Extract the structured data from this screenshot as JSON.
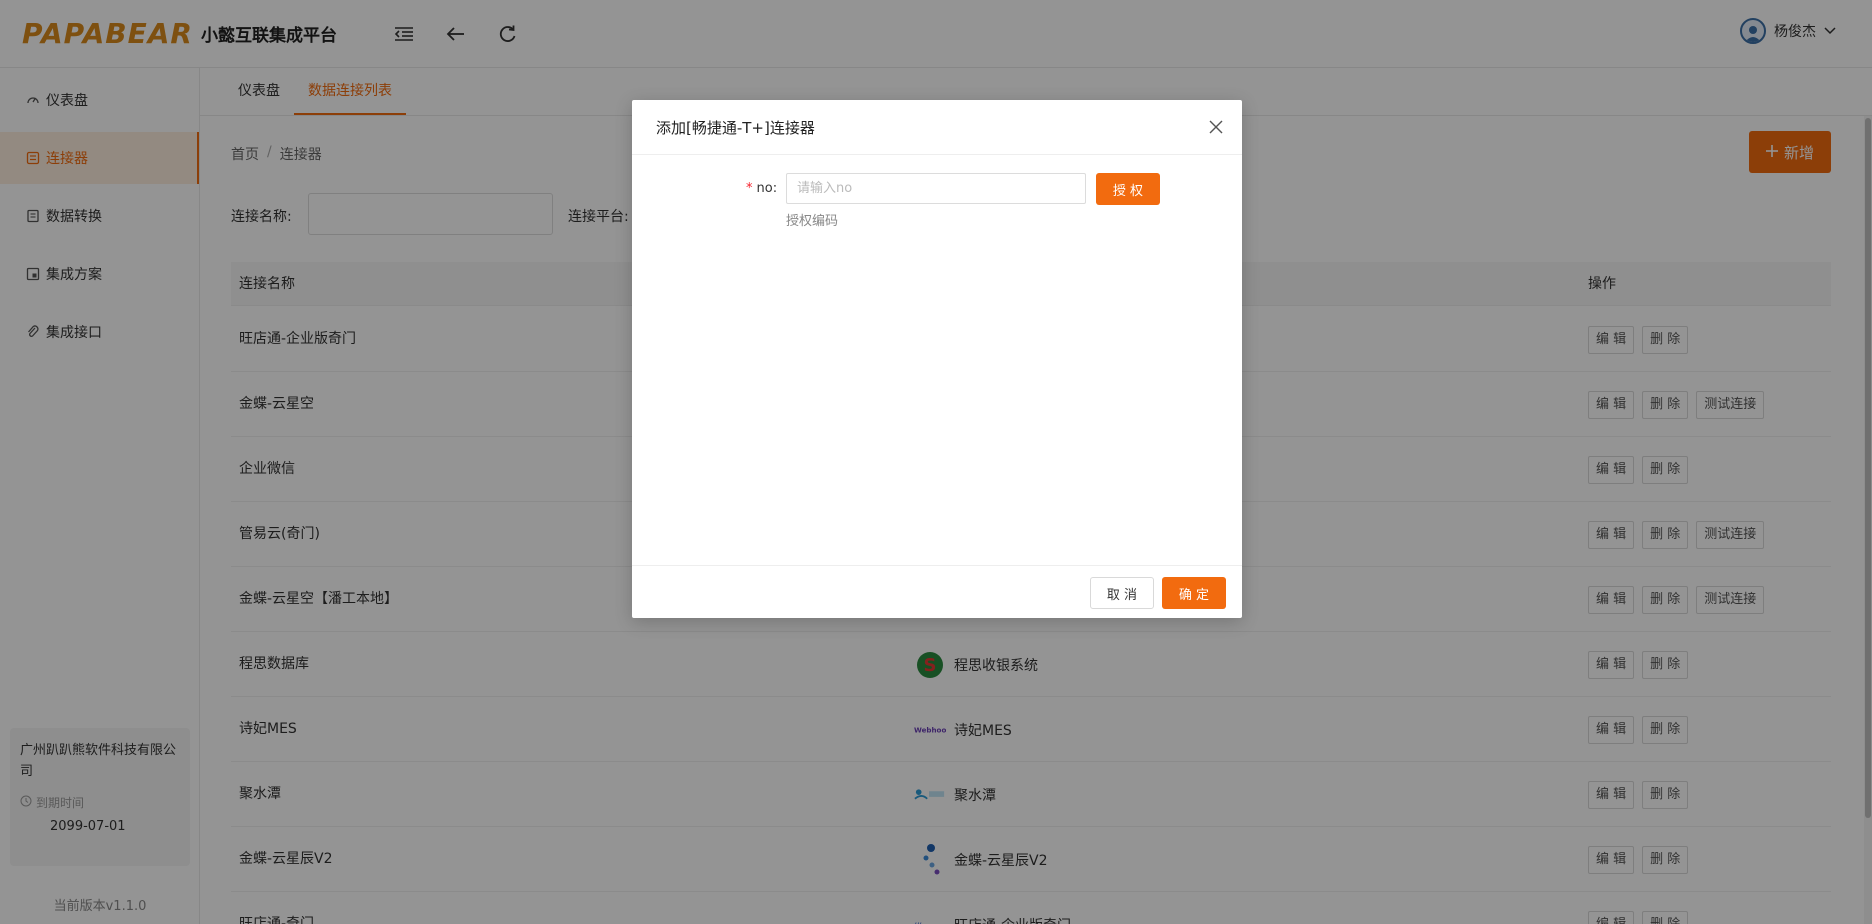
{
  "app": {
    "logo": "PAPABEAR",
    "platform_name": "小懿互联集成平台"
  },
  "header": {
    "user_name": "杨俊杰"
  },
  "sidebar": {
    "items": [
      {
        "label": "仪表盘",
        "icon": "dashboard-icon"
      },
      {
        "label": "连接器",
        "icon": "connector-icon",
        "active": true
      },
      {
        "label": "数据转换",
        "icon": "data-transform-icon"
      },
      {
        "label": "集成方案",
        "icon": "solution-icon"
      },
      {
        "label": "集成接口",
        "icon": "paperclip-icon"
      }
    ],
    "company": "广州趴趴熊软件科技有限公司",
    "expire_label": "到期时间",
    "expire_date": "2099-07-01",
    "version": "当前版本v1.1.0"
  },
  "tabs": [
    {
      "label": "仪表盘"
    },
    {
      "label": "数据连接列表",
      "active": true
    }
  ],
  "breadcrumb": {
    "home": "首页",
    "sep": "/",
    "current": "连接器"
  },
  "add_button": "新增",
  "filters": {
    "name_label": "连接名称:",
    "platform_label": "连接平台:"
  },
  "table": {
    "columns": {
      "name": "连接名称",
      "ops": "操作"
    },
    "op_labels": {
      "edit": "编 辑",
      "delete": "删 除",
      "test": "测试连接"
    },
    "rows": [
      {
        "name": "旺店通-企业版奇门",
        "platform": "",
        "test": false
      },
      {
        "name": "金蝶-云星空",
        "platform": "",
        "test": true
      },
      {
        "name": "企业微信",
        "platform": "",
        "test": false
      },
      {
        "name": "管易云(奇门)",
        "platform": "",
        "test": true
      },
      {
        "name": "金蝶-云星空【潘工本地】",
        "platform": "",
        "test": true
      },
      {
        "name": "程思数据库",
        "platform": "程思收银系统",
        "test": false
      },
      {
        "name": "诗妃MES",
        "platform": "诗妃MES",
        "test": false
      },
      {
        "name": "聚水潭",
        "platform": "聚水潭",
        "test": false
      },
      {
        "name": "金蝶-云星辰V2",
        "platform": "金蝶-云星辰V2",
        "test": false
      },
      {
        "name": "旺店通-奇门",
        "platform": "旺店通-企业版奇门",
        "test": false
      }
    ]
  },
  "modal": {
    "title": "添加[畅捷通-T+]连接器",
    "field_label": "no:",
    "required_mark": "*",
    "placeholder": "请输入no",
    "help": "授权编码",
    "auth_button": "授 权",
    "cancel": "取 消",
    "ok": "确 定"
  },
  "colors": {
    "accent": "#f26b0f",
    "logo": "#d98a1c"
  }
}
